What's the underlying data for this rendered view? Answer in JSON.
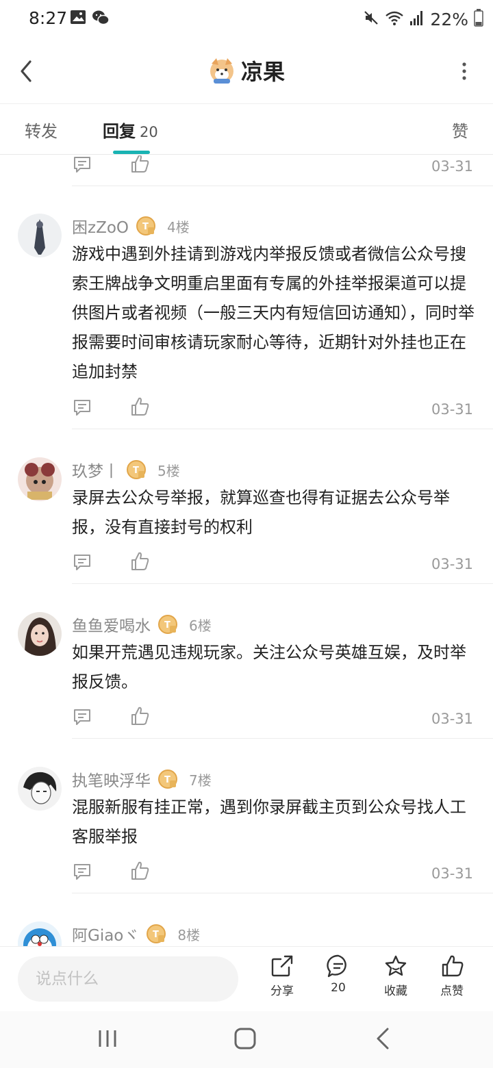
{
  "status": {
    "time": "8:27",
    "battery": "22%"
  },
  "header": {
    "title": "凉果"
  },
  "tabs": {
    "forward": "转发",
    "reply": "回复",
    "reply_count": "20",
    "like": "赞"
  },
  "top_row": {
    "date": "03-31"
  },
  "replies": [
    {
      "username": "困zZoO",
      "floor": "4楼",
      "text": "游戏中遇到外挂请到游戏内举报反馈或者微信公众号搜索王牌战争文明重启里面有专属的外挂举报渠道可以提供图片或者视频（一般三天内有短信回访通知），同时举报需要时间审核请玩家耐心等待，近期针对外挂也正在追加封禁",
      "date": "03-31"
    },
    {
      "username": "玖梦丨",
      "floor": "5楼",
      "text": "录屏去公众号举报，就算巡查也得有证据去公众号举报，没有直接封号的权利",
      "date": "03-31"
    },
    {
      "username": "鱼鱼爱喝水",
      "floor": "6楼",
      "text": "如果开荒遇见违规玩家。关注公众号英雄互娱，及时举报反馈。",
      "date": "03-31"
    },
    {
      "username": "执笔映浮华",
      "floor": "7楼",
      "text": "混服新服有挂正常，遇到你录屏截主页到公众号找人工客服举报",
      "date": "03-31"
    },
    {
      "username": "阿Giaoヾ",
      "floor": "8楼",
      "text": "",
      "date": ""
    }
  ],
  "bottom": {
    "placeholder": "说点什么",
    "share": "分享",
    "comment_count": "20",
    "collect": "收藏",
    "like": "点赞"
  },
  "colors": {
    "accent": "#19b3b3",
    "level_badge": "#e8b45a"
  }
}
